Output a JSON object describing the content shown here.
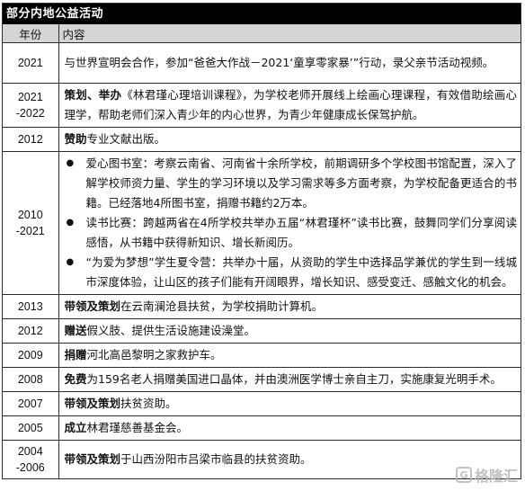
{
  "title": "部分内地公益活动",
  "headers": {
    "year": "年份",
    "content": "内容"
  },
  "rows": [
    {
      "year1": "2021",
      "year2": "",
      "bold": "",
      "text": "与世界宣明会合作，参加“爸爸大作战－2021‘童享零家暴’”行动，录父亲节活动视频。"
    },
    {
      "year1": "2021",
      "year2": "-2022",
      "bold": "策划、举办",
      "text": "《林君瑾心理培训课程》，为学校老师开展线上绘画心理课程，有效借助绘画心理学，帮助老师们深入青少年的内心世界，为青少年健康成长保驾护航。"
    },
    {
      "year1": "2012",
      "year2": "",
      "bold": "赞助",
      "text": "专业文献出版。"
    },
    {
      "year1": "2010",
      "year2": "-2021",
      "bold": "",
      "text": "",
      "bullets": [
        {
          "symbol": "●",
          "text": "爱心图书室：考察云南省、河南省十余所学校，前期调研多个学校图书馆配置，深入了解学校师资力量、学生的学习环境以及学习需求等多方面考察，为学校配备更适合的书籍。已经落地4所图书室，捐赠书籍约2万本。"
        },
        {
          "symbol": "●",
          "text": "读书比赛：跨越两省在4所学校共举办五届“林君瑾杯”读书比赛，鼓舞同学们分享阅读感悟，从书籍中获得新知识、增长新阅历。"
        },
        {
          "symbol": "●",
          "text": "“为爱为梦想”学生夏令营：共举办十届，从资助的学生中选择品学兼优的学生到一线城市深度体验，让山区的孩子们能有开阔眼界，增长知识、感受变迁、感触文化的机会。"
        }
      ]
    },
    {
      "year1": "2013",
      "year2": "",
      "bold": "带领及策划",
      "text": "在云南澜沧县扶贫，为学校捐助计算机。"
    },
    {
      "year1": "2012",
      "year2": "",
      "bold": "赠送",
      "text": "假义肢、提供生活设施建设澡堂。"
    },
    {
      "year1": "2009",
      "year2": "",
      "bold": "捐赠",
      "text": "河北高邑黎明之家救护车。"
    },
    {
      "year1": "2008",
      "year2": "",
      "bold": "免费",
      "text": "为159名老人捐赠美国进口晶体，并由澳洲医学博士亲自主刀，实施康复光明手术。"
    },
    {
      "year1": "2007",
      "year2": "",
      "bold": "带领及策划",
      "text": "扶贫资助。"
    },
    {
      "year1": "2005",
      "year2": "",
      "bold": "成立",
      "text": "林君瑾慈善基金会。"
    },
    {
      "year1": "2004",
      "year2": "-2006",
      "bold": "带领及策划",
      "text": "于山西汾阳市吕梁市临县的扶贫资助。"
    }
  ],
  "watermark": {
    "logo_text": "G",
    "text": "格隆汇"
  }
}
